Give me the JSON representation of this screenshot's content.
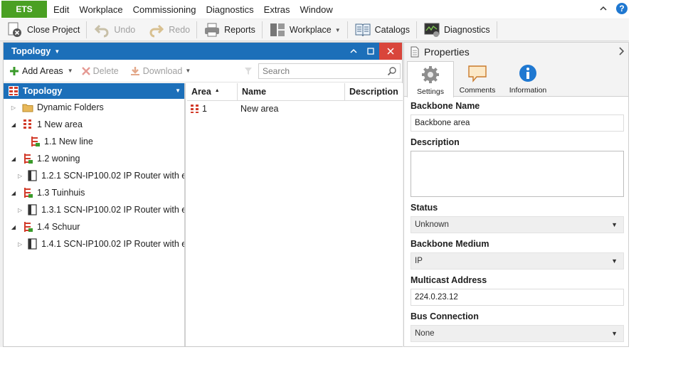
{
  "menubar": {
    "brand": "ETS",
    "items": [
      "Edit",
      "Workplace",
      "Commissioning",
      "Diagnostics",
      "Extras",
      "Window"
    ],
    "help_label": "?"
  },
  "toolbar": {
    "close_project": "Close Project",
    "undo": "Undo",
    "redo": "Redo",
    "reports": "Reports",
    "workplace": "Workplace",
    "catalogs": "Catalogs",
    "diagnostics": "Diagnostics"
  },
  "topology": {
    "title": "Topology",
    "tools": {
      "add_areas": "Add Areas",
      "delete": "Delete",
      "download": "Download"
    },
    "search": {
      "placeholder": "Search",
      "value": ""
    },
    "tree_root": "Topology",
    "tree": [
      {
        "label": "Dynamic Folders",
        "level": 0,
        "expand": "closed",
        "icon": "folder-icon"
      },
      {
        "label": "1 New area",
        "level": 0,
        "expand": "open",
        "icon": "area-icon"
      },
      {
        "label": "1.1 New line",
        "level": 1,
        "expand": "none",
        "icon": "line-icon"
      },
      {
        "label": "1.2 woning",
        "level": 0,
        "expand": "open",
        "icon": "line-icon"
      },
      {
        "label": "1.2.1 SCN-IP100.02 IP Router with e...",
        "level": 1,
        "expand": "closed",
        "icon": "device-icon"
      },
      {
        "label": "1.3 Tuinhuis",
        "level": 0,
        "expand": "open",
        "icon": "line-icon"
      },
      {
        "label": "1.3.1 SCN-IP100.02 IP Router with e...",
        "level": 1,
        "expand": "closed",
        "icon": "device-icon"
      },
      {
        "label": "1.4 Schuur",
        "level": 0,
        "expand": "open",
        "icon": "line-icon"
      },
      {
        "label": "1.4.1 SCN-IP100.02 IP Router with e...",
        "level": 1,
        "expand": "closed",
        "icon": "device-icon"
      }
    ],
    "grid": {
      "columns": [
        "Area",
        "Name",
        "Description"
      ],
      "sort_indicator": "▲",
      "rows": [
        {
          "area": "1",
          "name": "New area",
          "description": ""
        }
      ]
    }
  },
  "properties": {
    "title": "Properties",
    "tabs": [
      "Settings",
      "Comments",
      "Information"
    ],
    "fields": {
      "backbone_name_label": "Backbone Name",
      "backbone_name_value": "Backbone area",
      "description_label": "Description",
      "status_label": "Status",
      "status_value": "Unknown",
      "backbone_medium_label": "Backbone Medium",
      "backbone_medium_value": "IP",
      "multicast_label": "Multicast Address",
      "multicast_value": "224.0.23.12",
      "bus_connection_label": "Bus Connection",
      "bus_connection_value": "None"
    }
  },
  "colors": {
    "brand_green": "#4aa023",
    "header_blue": "#1c6fb9",
    "close_red": "#d9453b",
    "area_red": "#d23b2a",
    "help_blue": "#1f78d1"
  }
}
